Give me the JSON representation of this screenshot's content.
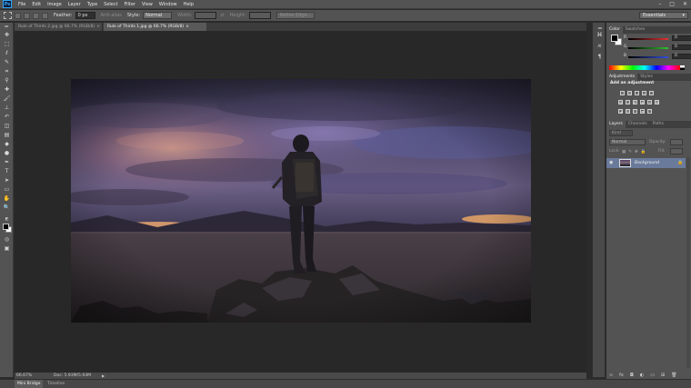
{
  "app": {
    "logo_text": "Ps"
  },
  "menu": [
    "File",
    "Edit",
    "Image",
    "Layer",
    "Type",
    "Select",
    "Filter",
    "View",
    "Window",
    "Help"
  ],
  "window_controls": {
    "minimize": "–",
    "maximize": "□",
    "close": "✕"
  },
  "options_bar": {
    "feather_label": "Feather:",
    "feather_value": "0 px",
    "antialias_label": "Anti-alias",
    "style_label": "Style:",
    "style_value": "Normal",
    "width_label": "Width:",
    "height_label": "Height:",
    "refine_edge_label": "Refine Edge...",
    "workspace": "Essentials"
  },
  "doc_tabs": [
    {
      "title": "Rule of Thirds 2.jpg @ 66.7% (RGB/8)",
      "close": "×"
    },
    {
      "title": "Rule of Thirds 1.jpg @ 66.7% (RGB/8)",
      "close": "×"
    }
  ],
  "status_bar": {
    "zoom": "66.67%",
    "doc_size": "Doc: 5.93M/5.93M",
    "arrow": "▶"
  },
  "bottom_tabs": [
    "Mini Bridge",
    "Timeline"
  ],
  "color_panel": {
    "tabs": [
      "Color",
      "Swatches"
    ],
    "channels": [
      {
        "label": "R",
        "value": "0",
        "track_color": "#e03030"
      },
      {
        "label": "G",
        "value": "0",
        "track_color": "#30c030"
      },
      {
        "label": "B",
        "value": "0",
        "track_color": "#3050e0"
      }
    ]
  },
  "adjustments_panel": {
    "tabs": [
      "Adjustments",
      "Styles"
    ],
    "title": "Add an adjustment"
  },
  "layers_panel": {
    "tabs": [
      "Layers",
      "Channels",
      "Paths"
    ],
    "filter": "Kind",
    "blend_mode": "Normal",
    "opacity_label": "Opacity:",
    "lock_label": "Lock:",
    "fill_label": "Fill:",
    "layer_name": "Background"
  },
  "colors": {
    "ui_dark": "#2b2b2b",
    "panel": "#535353",
    "accent": "#31a8ff",
    "selected_layer": "#6a7a9a"
  }
}
